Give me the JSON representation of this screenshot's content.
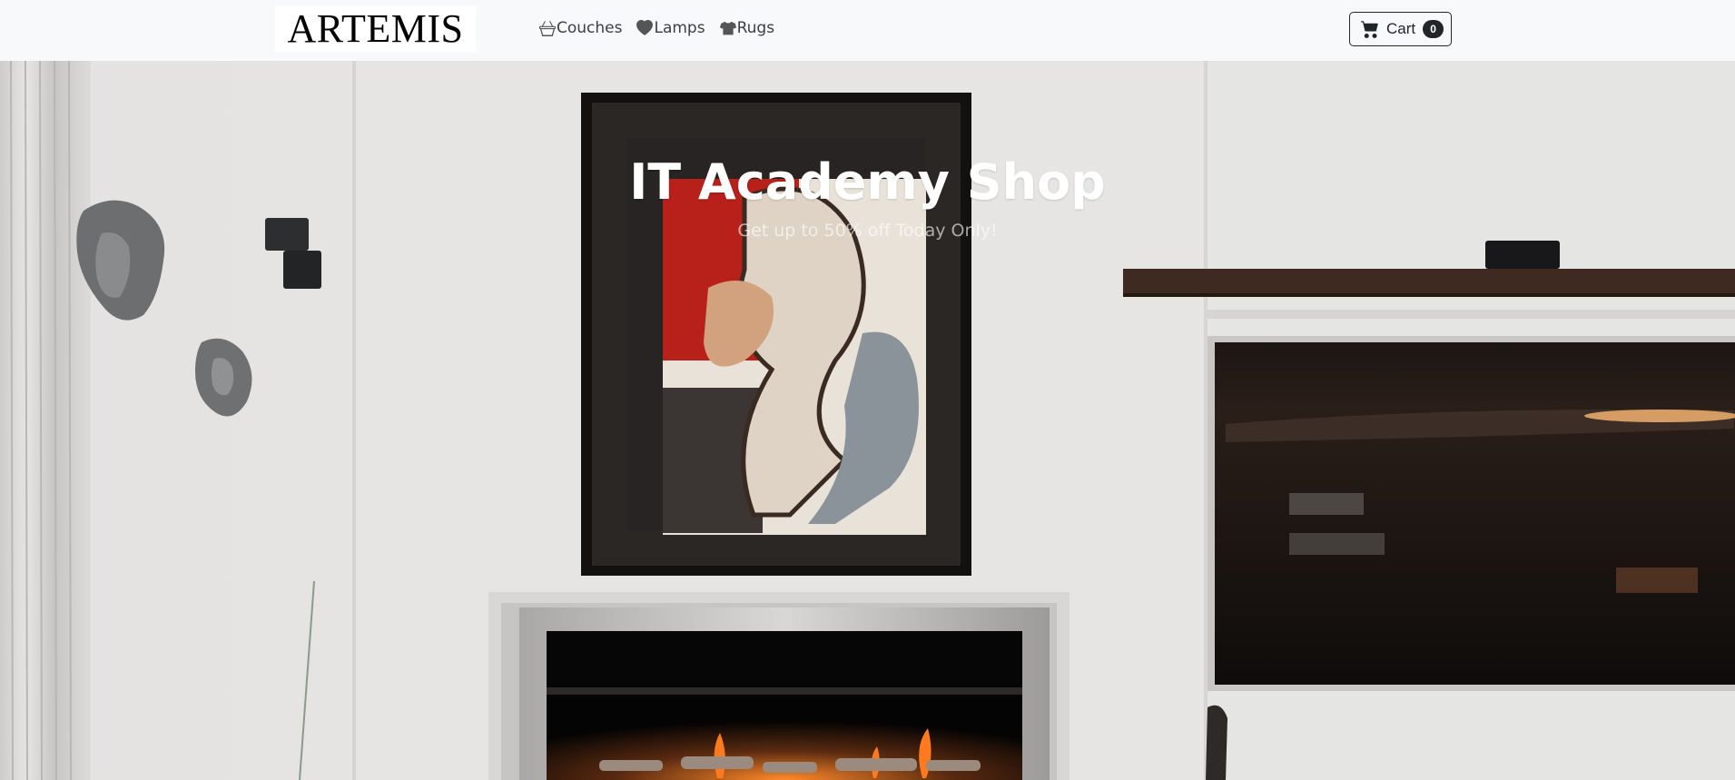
{
  "navbar": {
    "brand": "ARTEMIS",
    "links": [
      {
        "label": "Couches",
        "icon": "basket-icon"
      },
      {
        "label": "Lamps",
        "icon": "heart-icon"
      },
      {
        "label": "Rugs",
        "icon": "tshirt-icon"
      }
    ],
    "cart": {
      "label": "Cart",
      "count": "0",
      "icon": "cart-icon"
    }
  },
  "hero": {
    "title": "IT Academy Shop",
    "subtitle": "Get up to 50% off Today Only!"
  },
  "colors": {
    "navbar_bg": "#f8f9fa",
    "text_dark": "#212529",
    "hero_title": "#ffffff"
  }
}
